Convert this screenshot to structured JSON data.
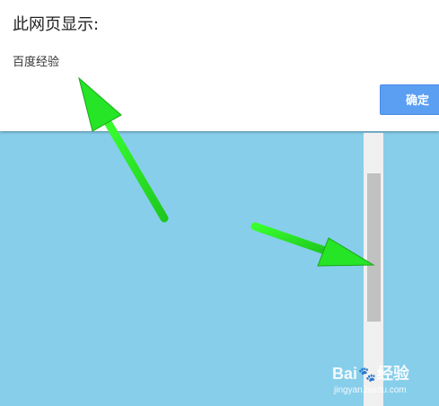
{
  "dialog": {
    "title": "此网页显示:",
    "message": "百度经验",
    "ok_label": "确定"
  },
  "watermark": {
    "brand_prefix": "Bai",
    "paw_icon": "🐾",
    "brand_suffix": "经验",
    "url": "jingyan.baidu.com"
  },
  "colors": {
    "page_background": "#87ceeb",
    "dialog_background": "#ffffff",
    "ok_button": "#5b9ff3",
    "arrow": "#22e022",
    "scrollbar_track": "#f0f0f0",
    "scrollbar_thumb": "#c1c1c1"
  },
  "icons": {
    "arrows": [
      "green-arrow-icon",
      "green-arrow-icon"
    ],
    "watermark_logo": "paw-icon"
  }
}
